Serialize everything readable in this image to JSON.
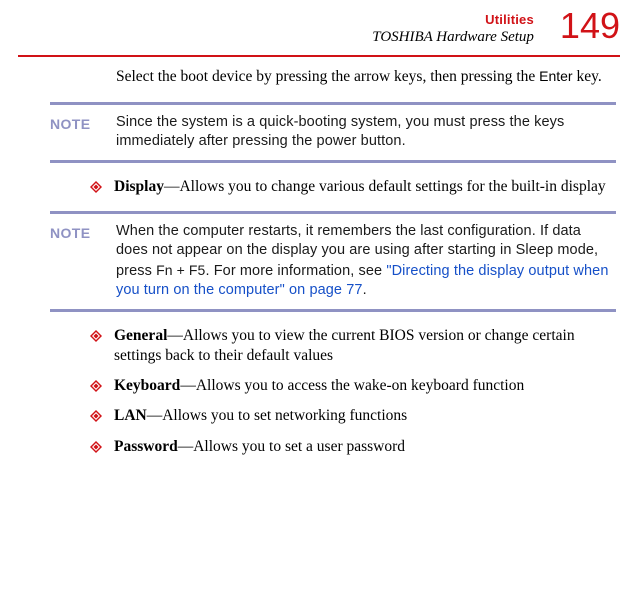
{
  "header": {
    "category": "Utilities",
    "section": "TOSHIBA Hardware Setup",
    "page_number": "149"
  },
  "intro": {
    "part1": "Select the boot device by pressing the arrow keys, then pressing the ",
    "key": "Enter",
    "part2": " key."
  },
  "notes": {
    "label": "NOTE",
    "note1": "Since the system is a quick-booting system, you must press the keys immediately after pressing the power button.",
    "note2_a": "When the computer restarts, it remembers the last configuration. If data does not appear on the display you are using after starting in Sleep mode, press ",
    "note2_key": "Fn + F5",
    "note2_b": ". For more information, see ",
    "note2_link": "\"Directing the display output when you turn on the computer\" on page 77",
    "note2_c": "."
  },
  "bullets": {
    "b1_term": "Display",
    "b1_desc": "—Allows you to change various default settings for the built-in display",
    "b2_term": "General",
    "b2_desc": "—Allows you to view the current BIOS version or change certain settings back to their default values",
    "b3_term": "Keyboard",
    "b3_desc": "—Allows you to access the wake-on keyboard function",
    "b4_term": "LAN",
    "b4_desc": "—Allows you to set networking functions",
    "b5_term": "Password",
    "b5_desc": "—Allows you to set a user password"
  }
}
